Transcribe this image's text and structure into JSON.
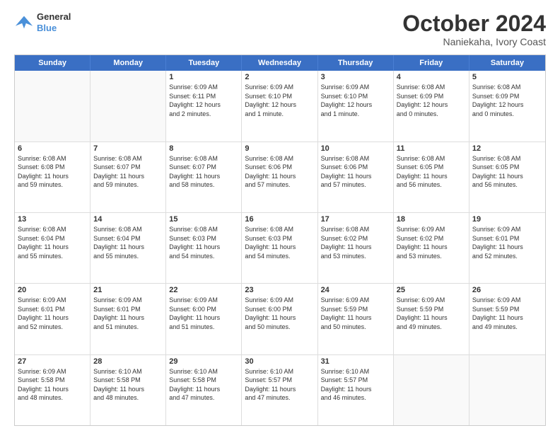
{
  "header": {
    "logo_line1": "General",
    "logo_line2": "Blue",
    "month_title": "October 2024",
    "location": "Naniekaha, Ivory Coast"
  },
  "days_of_week": [
    "Sunday",
    "Monday",
    "Tuesday",
    "Wednesday",
    "Thursday",
    "Friday",
    "Saturday"
  ],
  "weeks": [
    [
      {
        "day": "",
        "info": ""
      },
      {
        "day": "",
        "info": ""
      },
      {
        "day": "1",
        "info": "Sunrise: 6:09 AM\nSunset: 6:11 PM\nDaylight: 12 hours\nand 2 minutes."
      },
      {
        "day": "2",
        "info": "Sunrise: 6:09 AM\nSunset: 6:10 PM\nDaylight: 12 hours\nand 1 minute."
      },
      {
        "day": "3",
        "info": "Sunrise: 6:09 AM\nSunset: 6:10 PM\nDaylight: 12 hours\nand 1 minute."
      },
      {
        "day": "4",
        "info": "Sunrise: 6:08 AM\nSunset: 6:09 PM\nDaylight: 12 hours\nand 0 minutes."
      },
      {
        "day": "5",
        "info": "Sunrise: 6:08 AM\nSunset: 6:09 PM\nDaylight: 12 hours\nand 0 minutes."
      }
    ],
    [
      {
        "day": "6",
        "info": "Sunrise: 6:08 AM\nSunset: 6:08 PM\nDaylight: 11 hours\nand 59 minutes."
      },
      {
        "day": "7",
        "info": "Sunrise: 6:08 AM\nSunset: 6:07 PM\nDaylight: 11 hours\nand 59 minutes."
      },
      {
        "day": "8",
        "info": "Sunrise: 6:08 AM\nSunset: 6:07 PM\nDaylight: 11 hours\nand 58 minutes."
      },
      {
        "day": "9",
        "info": "Sunrise: 6:08 AM\nSunset: 6:06 PM\nDaylight: 11 hours\nand 57 minutes."
      },
      {
        "day": "10",
        "info": "Sunrise: 6:08 AM\nSunset: 6:06 PM\nDaylight: 11 hours\nand 57 minutes."
      },
      {
        "day": "11",
        "info": "Sunrise: 6:08 AM\nSunset: 6:05 PM\nDaylight: 11 hours\nand 56 minutes."
      },
      {
        "day": "12",
        "info": "Sunrise: 6:08 AM\nSunset: 6:05 PM\nDaylight: 11 hours\nand 56 minutes."
      }
    ],
    [
      {
        "day": "13",
        "info": "Sunrise: 6:08 AM\nSunset: 6:04 PM\nDaylight: 11 hours\nand 55 minutes."
      },
      {
        "day": "14",
        "info": "Sunrise: 6:08 AM\nSunset: 6:04 PM\nDaylight: 11 hours\nand 55 minutes."
      },
      {
        "day": "15",
        "info": "Sunrise: 6:08 AM\nSunset: 6:03 PM\nDaylight: 11 hours\nand 54 minutes."
      },
      {
        "day": "16",
        "info": "Sunrise: 6:08 AM\nSunset: 6:03 PM\nDaylight: 11 hours\nand 54 minutes."
      },
      {
        "day": "17",
        "info": "Sunrise: 6:08 AM\nSunset: 6:02 PM\nDaylight: 11 hours\nand 53 minutes."
      },
      {
        "day": "18",
        "info": "Sunrise: 6:09 AM\nSunset: 6:02 PM\nDaylight: 11 hours\nand 53 minutes."
      },
      {
        "day": "19",
        "info": "Sunrise: 6:09 AM\nSunset: 6:01 PM\nDaylight: 11 hours\nand 52 minutes."
      }
    ],
    [
      {
        "day": "20",
        "info": "Sunrise: 6:09 AM\nSunset: 6:01 PM\nDaylight: 11 hours\nand 52 minutes."
      },
      {
        "day": "21",
        "info": "Sunrise: 6:09 AM\nSunset: 6:01 PM\nDaylight: 11 hours\nand 51 minutes."
      },
      {
        "day": "22",
        "info": "Sunrise: 6:09 AM\nSunset: 6:00 PM\nDaylight: 11 hours\nand 51 minutes."
      },
      {
        "day": "23",
        "info": "Sunrise: 6:09 AM\nSunset: 6:00 PM\nDaylight: 11 hours\nand 50 minutes."
      },
      {
        "day": "24",
        "info": "Sunrise: 6:09 AM\nSunset: 5:59 PM\nDaylight: 11 hours\nand 50 minutes."
      },
      {
        "day": "25",
        "info": "Sunrise: 6:09 AM\nSunset: 5:59 PM\nDaylight: 11 hours\nand 49 minutes."
      },
      {
        "day": "26",
        "info": "Sunrise: 6:09 AM\nSunset: 5:59 PM\nDaylight: 11 hours\nand 49 minutes."
      }
    ],
    [
      {
        "day": "27",
        "info": "Sunrise: 6:09 AM\nSunset: 5:58 PM\nDaylight: 11 hours\nand 48 minutes."
      },
      {
        "day": "28",
        "info": "Sunrise: 6:10 AM\nSunset: 5:58 PM\nDaylight: 11 hours\nand 48 minutes."
      },
      {
        "day": "29",
        "info": "Sunrise: 6:10 AM\nSunset: 5:58 PM\nDaylight: 11 hours\nand 47 minutes."
      },
      {
        "day": "30",
        "info": "Sunrise: 6:10 AM\nSunset: 5:57 PM\nDaylight: 11 hours\nand 47 minutes."
      },
      {
        "day": "31",
        "info": "Sunrise: 6:10 AM\nSunset: 5:57 PM\nDaylight: 11 hours\nand 46 minutes."
      },
      {
        "day": "",
        "info": ""
      },
      {
        "day": "",
        "info": ""
      }
    ]
  ]
}
